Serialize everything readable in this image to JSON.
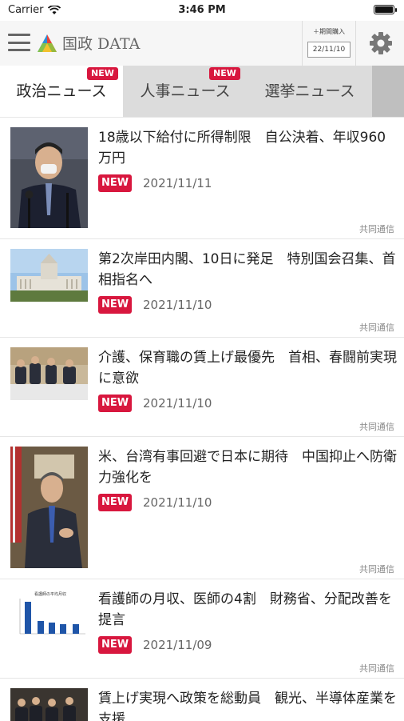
{
  "status_bar": {
    "carrier": "Carrier",
    "time": "3:46 PM"
  },
  "app_bar": {
    "app_name": "国政 DATA",
    "purchase_label": "＋期間購入",
    "purchase_date": "22/11/10"
  },
  "tabs": [
    {
      "label": "政治ニュース",
      "badge": "NEW",
      "active": true
    },
    {
      "label": "人事ニュース",
      "badge": "NEW",
      "active": false
    },
    {
      "label": "選挙ニュース",
      "badge": "",
      "active": false
    }
  ],
  "articles": [
    {
      "title": "18歳以下給付に所得制限　自公決着、年収960万円",
      "badge": "NEW",
      "date": "2021/11/11",
      "source": "共同通信",
      "thumbnail": "politician-speaking"
    },
    {
      "title": "第2次岸田内閣、10日に発足　特別国会召集、首相指名へ",
      "badge": "NEW",
      "date": "2021/11/10",
      "source": "共同通信",
      "thumbnail": "diet-building"
    },
    {
      "title": "介護、保育職の賃上げ最優先　首相、春闘前実現に意欲",
      "badge": "NEW",
      "date": "2021/11/10",
      "source": "共同通信",
      "thumbnail": "meeting"
    },
    {
      "title": "米、台湾有事回避で日本に期待　中国抑止へ防衛力強化を",
      "badge": "NEW",
      "date": "2021/11/10",
      "source": "共同通信",
      "thumbnail": "interview"
    },
    {
      "title": "看護師の月収、医師の4割　財務省、分配改善を提言",
      "badge": "NEW",
      "date": "2021/11/09",
      "source": "共同通信",
      "thumbnail": "bar-chart",
      "thumbnail_text": "看護師の平均月収"
    },
    {
      "title": "賃上げ実現へ政策を総動員　観光、半導体産業を支援",
      "badge": "",
      "date": "",
      "source": "",
      "thumbnail": "meeting"
    }
  ]
}
